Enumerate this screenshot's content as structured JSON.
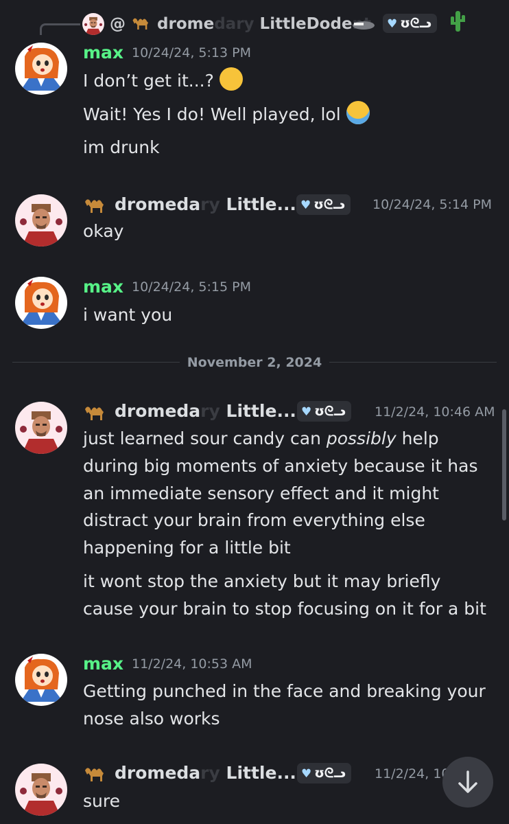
{
  "reply": {
    "at": "@",
    "name_a": "drome",
    "name_b": "dary",
    "name_c": " LittleDode",
    "name_d": "nt"
  },
  "badge": {
    "text": "ʊᘓᓗ"
  },
  "messages": [
    {
      "author": "max",
      "time": "10/24/24, 5:13 PM",
      "lines": [
        "I don’t get it...?",
        "Wait! Yes I do! Well played, lol",
        "im drunk"
      ]
    },
    {
      "author_a": "dromeda",
      "author_b": "ry",
      "author_c": " Little...",
      "time": "10/24/24, 5:14 PM",
      "lines": [
        "okay"
      ]
    },
    {
      "author": "max",
      "time": "10/24/24, 5:15 PM",
      "lines": [
        "i want you"
      ]
    },
    {
      "author_a": "dromeda",
      "author_b": "ry",
      "author_c": " Little...",
      "time": "11/2/24, 10:46 AM",
      "lines": [
        "just learned sour candy can ",
        "possibly",
        " help",
        "during big moments of anxiety because it has",
        "an immediate sensory effect and it might",
        "distract your brain from everything else",
        "happening for a little bit",
        "it wont stop the anxiety but it may briefly",
        "cause your brain to stop focusing on it for a bit"
      ]
    },
    {
      "author": "max",
      "time": "11/2/24, 10:53 AM",
      "lines": [
        "Getting punched in the face and breaking your",
        "nose also works"
      ]
    },
    {
      "author_a": "dromeda",
      "author_b": "ry",
      "author_c": " Little...",
      "time": "11/2/24, 10",
      "lines": [
        "sure"
      ]
    }
  ],
  "divider": {
    "label": "November 2, 2024"
  },
  "colors": {
    "max": "#57f287",
    "dromedary": "#dbdee1",
    "background": "#1c1d22"
  },
  "icons": {
    "scroll_button": "arrow-down-icon"
  }
}
